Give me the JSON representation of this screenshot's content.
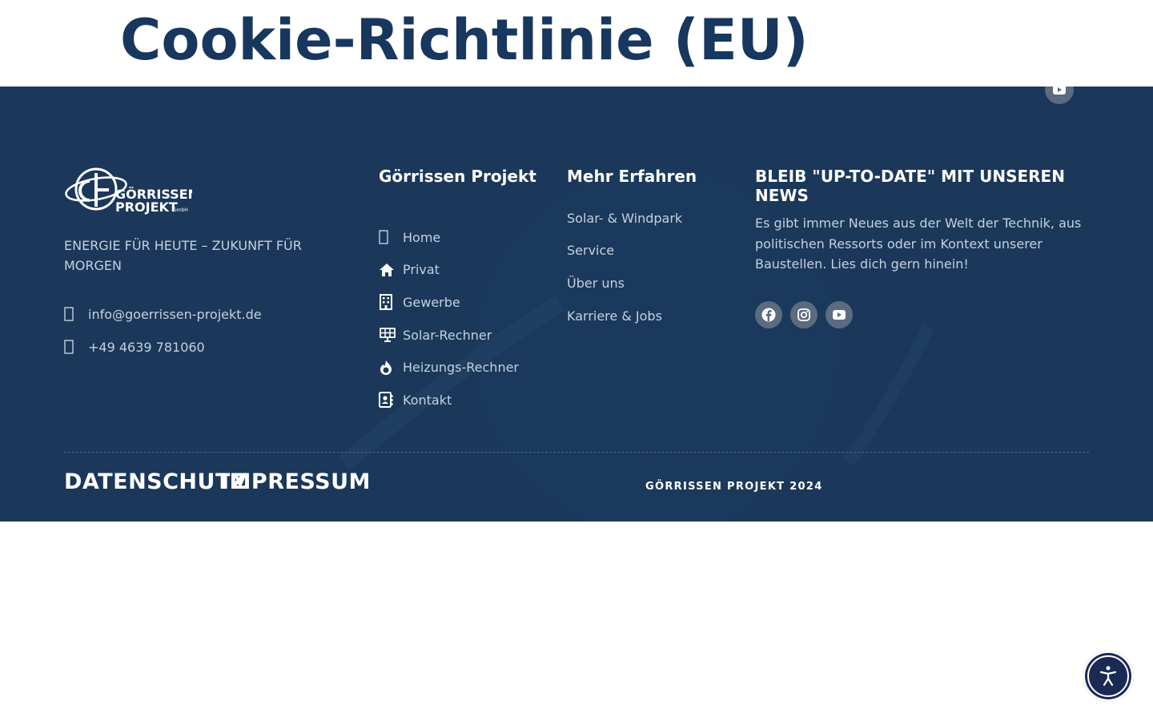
{
  "page": {
    "title": "Cookie-Richtlinie (EU)"
  },
  "footer": {
    "brand": {
      "logo_line1": "GÖRRISSEN",
      "logo_line2": "PROJEKT",
      "logo_suffix": "GmbH",
      "tagline": "ENERGIE FÜR HEUTE – ZUKUNFT FÜR MORGEN",
      "email": "info@goerrissen-projekt.de",
      "phone": "+49 4639 781060"
    },
    "nav": {
      "title": "Görrissen Projekt",
      "items": [
        {
          "label": "Home",
          "icon": "box-icon"
        },
        {
          "label": "Privat",
          "icon": "house-icon"
        },
        {
          "label": "Gewerbe",
          "icon": "building-icon"
        },
        {
          "label": "Solar-Rechner",
          "icon": "solar-panel-icon"
        },
        {
          "label": "Heizungs-Rechner",
          "icon": "fire-icon"
        },
        {
          "label": "Kontakt",
          "icon": "address-book-icon"
        }
      ]
    },
    "more": {
      "title": "Mehr Erfahren",
      "items": [
        {
          "label": "Solar- & Windpark"
        },
        {
          "label": "Service"
        },
        {
          "label": "Über uns"
        },
        {
          "label": "Karriere & Jobs"
        }
      ]
    },
    "news": {
      "title": "BLEIB \"UP-TO-DATE\" MIT UNSEREN NEWS",
      "text": "Es gibt immer Neues aus der Welt der Technik, aus politischen Ressorts oder im Kontext unserer Baustellen. Lies dich gern hinein!",
      "socials": [
        "facebook-icon",
        "instagram-icon",
        "youtube-icon"
      ]
    },
    "legal": {
      "privacy": "DATENSCHUTZ",
      "imprint": "IMPRESSUM",
      "copyright": "GÖRRISSEN PROJEKT 2024"
    }
  },
  "colors": {
    "title": "#17375e",
    "footer_bg": "#1b385a",
    "social_bg": "#5b6b80",
    "a11y_bg": "#1b2a55"
  }
}
